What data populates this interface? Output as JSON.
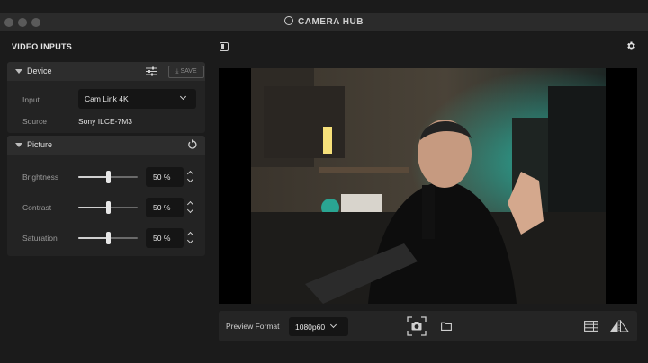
{
  "window": {
    "title": "CAMERA HUB"
  },
  "sidebar": {
    "header": "VIDEO INPUTS",
    "device": {
      "title": "Device",
      "save_label": "SAVE",
      "input_label": "Input",
      "input_value": "Cam Link 4K",
      "source_label": "Source",
      "source_value": "Sony ILCE-7M3"
    },
    "picture": {
      "title": "Picture",
      "controls": [
        {
          "label": "Brightness",
          "value": "50 %",
          "level": 0.5
        },
        {
          "label": "Contrast",
          "value": "50 %",
          "level": 0.5
        },
        {
          "label": "Saturation",
          "value": "50 %",
          "level": 0.5
        }
      ]
    }
  },
  "toolbar": {
    "preview_format_label": "Preview Format",
    "preview_format_value": "1080p60"
  },
  "icons": {
    "app_logo": "camera-hub-logo-icon",
    "settings": "gear-icon",
    "panel": "sidebar-toggle-icon",
    "snapshot": "snapshot-icon",
    "folder": "folder-icon",
    "grid": "grid-icon",
    "mirror": "mirror-icon",
    "reset": "reset-icon",
    "adjust": "sliders-icon"
  },
  "colors": {
    "background": "#1b1b1b",
    "panel": "#232323",
    "accent": "#e6e6e6"
  }
}
